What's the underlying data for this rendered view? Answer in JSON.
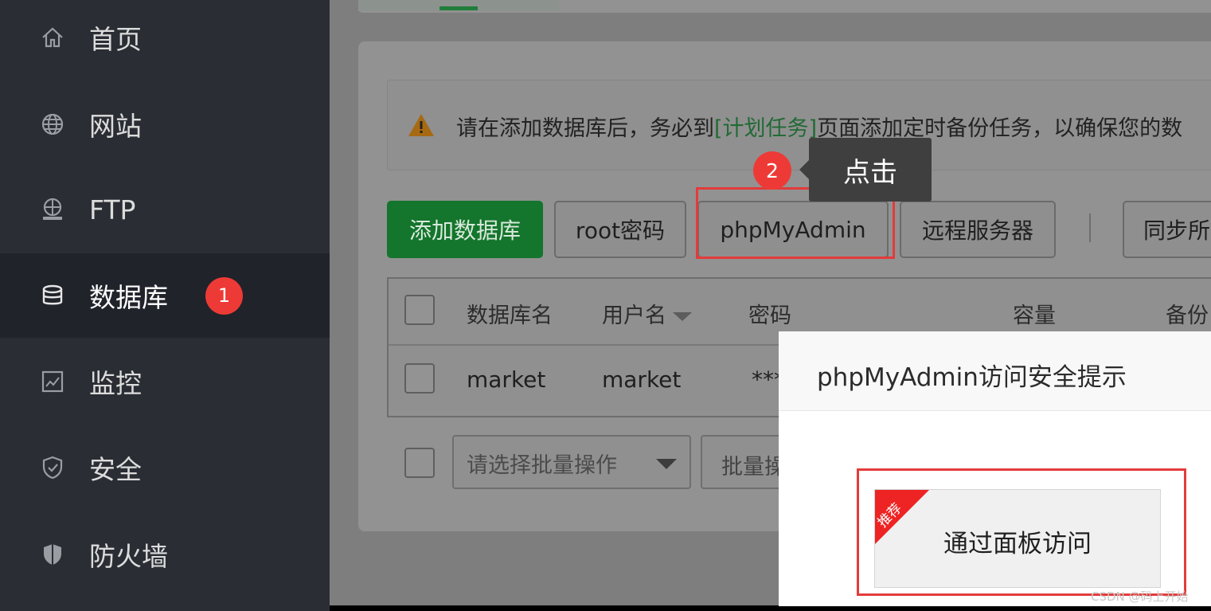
{
  "sidebar": {
    "items": [
      {
        "label": "首页",
        "icon": "home-icon"
      },
      {
        "label": "网站",
        "icon": "globe-icon"
      },
      {
        "label": "FTP",
        "icon": "ftp-icon"
      },
      {
        "label": "数据库",
        "icon": "database-icon",
        "active": true,
        "badge": "1"
      },
      {
        "label": "监控",
        "icon": "monitor-icon"
      },
      {
        "label": "安全",
        "icon": "shield-icon"
      },
      {
        "label": "防火墙",
        "icon": "firewall-icon"
      }
    ]
  },
  "notice": {
    "text_before": "请在添加数据库后，务必到",
    "link": "[计划任务]",
    "text_after": "页面添加定时备份任务，以确保您的数"
  },
  "toolbar": {
    "add_db": "添加数据库",
    "root_pwd": "root密码",
    "phpmyadmin": "phpMyAdmin",
    "remote_server": "远程服务器",
    "sync": "同步所"
  },
  "annotation": {
    "step_badge": "2",
    "tooltip": "点击"
  },
  "table": {
    "headers": [
      "数据库名",
      "用户名",
      "密码",
      "容量",
      "备份"
    ],
    "rows": [
      {
        "name": "market",
        "user": "market",
        "password": "***"
      }
    ]
  },
  "footer": {
    "bulk_select_placeholder": "请选择批量操作",
    "bulk_button": "批量操"
  },
  "dialog": {
    "title": "phpMyAdmin访问安全提示",
    "ribbon": "推荐",
    "panel_access": "通过面板访问"
  },
  "watermark": "CSDN @码上开始",
  "colors": {
    "accent_green": "#14752c",
    "badge_red": "#ee3a36",
    "highlight_red": "#e33b3b",
    "sidebar_bg": "#2a2e34"
  }
}
